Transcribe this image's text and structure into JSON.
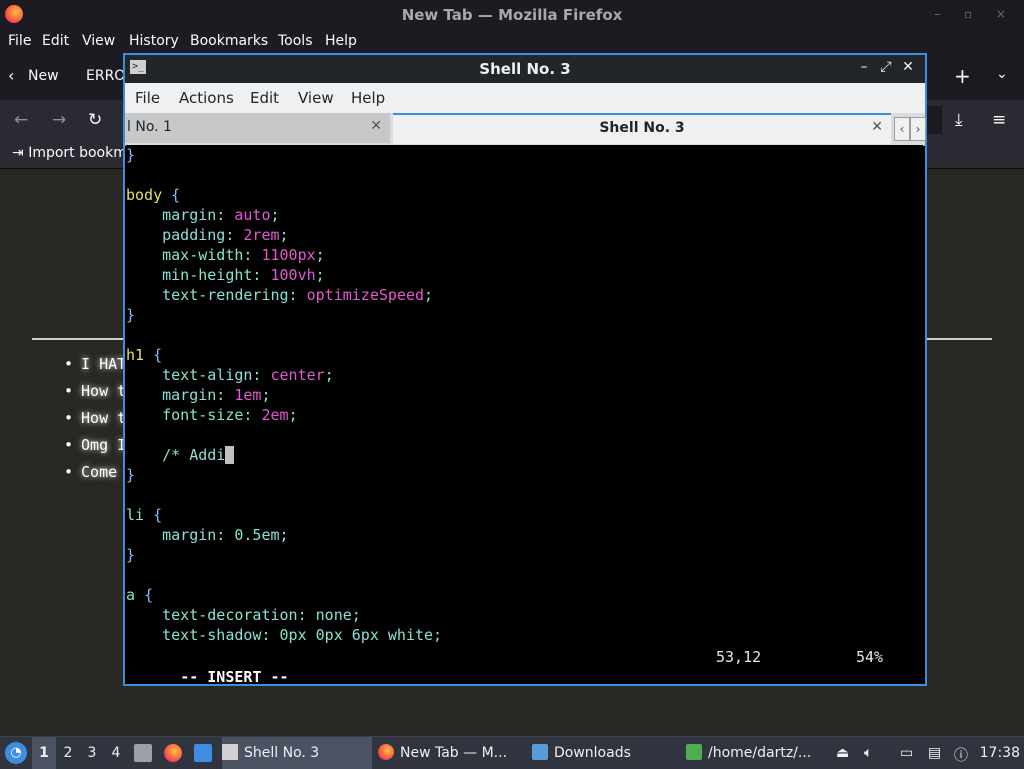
{
  "firefox": {
    "title": "New Tab — Mozilla Firefox",
    "menu": [
      "File",
      "Edit",
      "View",
      "History",
      "Bookmarks",
      "Tools",
      "Help"
    ],
    "tabs": [
      "New",
      "ERRO"
    ],
    "bookmark": "Import bookm",
    "list_items": [
      "I HAT",
      "How t",
      "How t",
      "Omg I",
      "Come"
    ]
  },
  "konsole": {
    "title": "Shell No. 3",
    "menu": [
      "File",
      "Actions",
      "Edit",
      "View",
      "Help"
    ],
    "tabs": [
      {
        "label": "l No. 1",
        "active": false
      },
      {
        "label": "Shell No. 3",
        "active": true
      }
    ],
    "terminal_lines": [
      "}",
      "",
      "body {",
      "    margin: auto;",
      "    padding: 2rem;",
      "    max-width: 1100px;",
      "    min-height: 100vh;",
      "    text-rendering: optimizeSpeed;",
      "}",
      "",
      "h1 {",
      "    text-align: center;",
      "    margin: 1em;",
      "    font-size: 2em;",
      "",
      "    /* Addi",
      "}",
      "",
      "li {",
      "    margin: 0.5em;",
      "}",
      "",
      "a {",
      "    text-decoration: none;",
      "    text-shadow: 0px 0px 6px white;"
    ],
    "status": {
      "mode": "-- INSERT --",
      "position": "53,12",
      "percent": "54%"
    }
  },
  "taskbar": {
    "workspaces": [
      "1",
      "2",
      "3",
      "4"
    ],
    "active_workspace": "1",
    "tasks": [
      {
        "label": "Shell No. 3",
        "icon": "terminal-icon",
        "active": true
      },
      {
        "label": "New Tab — M...",
        "icon": "firefox-icon",
        "active": false
      },
      {
        "label": "Downloads",
        "icon": "folder-icon",
        "active": false
      },
      {
        "label": "/home/dartz/...",
        "icon": "archive-icon",
        "active": false
      }
    ],
    "clock": "17:38"
  }
}
